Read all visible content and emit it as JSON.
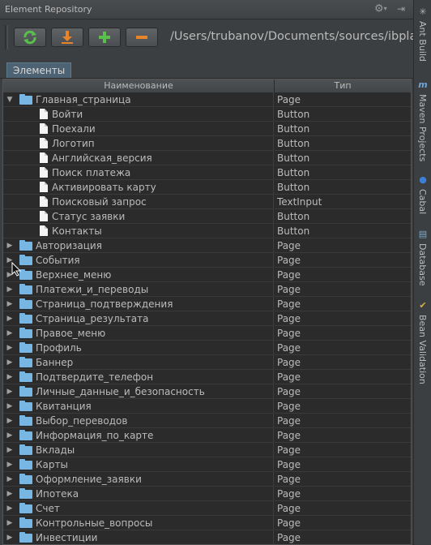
{
  "window": {
    "title": "Element Repository"
  },
  "toolbar": {
    "buttons": [
      {
        "name": "refresh",
        "icon": "refresh-icon"
      },
      {
        "name": "download",
        "icon": "download-icon"
      },
      {
        "name": "add",
        "icon": "plus-icon"
      },
      {
        "name": "remove",
        "icon": "minus-icon"
      }
    ],
    "path": "/Users/trubanov/Documents/sources/ibplatfor"
  },
  "tabs": [
    {
      "label": "Элементы",
      "active": true
    }
  ],
  "table": {
    "columns": [
      "Наименование",
      "Тип"
    ],
    "rows": [
      {
        "name": "Главная_страница",
        "type": "Page",
        "kind": "folder",
        "expanded": true
      },
      {
        "name": "Войти",
        "type": "Button",
        "kind": "leaf"
      },
      {
        "name": "Поехали",
        "type": "Button",
        "kind": "leaf"
      },
      {
        "name": "Логотип",
        "type": "Button",
        "kind": "leaf"
      },
      {
        "name": "Английская_версия",
        "type": "Button",
        "kind": "leaf"
      },
      {
        "name": "Поиск платежа",
        "type": "Button",
        "kind": "leaf"
      },
      {
        "name": "Активировать карту",
        "type": "Button",
        "kind": "leaf"
      },
      {
        "name": "Поисковый запрос",
        "type": "TextInput",
        "kind": "leaf"
      },
      {
        "name": "Статус заявки",
        "type": "Button",
        "kind": "leaf"
      },
      {
        "name": "Контакты",
        "type": "Button",
        "kind": "leaf"
      },
      {
        "name": "Авторизация",
        "type": "Page",
        "kind": "folder",
        "expanded": false
      },
      {
        "name": "События",
        "type": "Page",
        "kind": "folder",
        "expanded": false
      },
      {
        "name": "Верхнее_меню",
        "type": "Page",
        "kind": "folder",
        "expanded": false
      },
      {
        "name": "Платежи_и_переводы",
        "type": "Page",
        "kind": "folder",
        "expanded": false
      },
      {
        "name": "Страница_подтверждения",
        "type": "Page",
        "kind": "folder",
        "expanded": false
      },
      {
        "name": "Страница_результата",
        "type": "Page",
        "kind": "folder",
        "expanded": false
      },
      {
        "name": "Правое_меню",
        "type": "Page",
        "kind": "folder",
        "expanded": false
      },
      {
        "name": "Профиль",
        "type": "Page",
        "kind": "folder",
        "expanded": false
      },
      {
        "name": "Баннер",
        "type": "Page",
        "kind": "folder",
        "expanded": false
      },
      {
        "name": "Подтвердите_телефон",
        "type": "Page",
        "kind": "folder",
        "expanded": false
      },
      {
        "name": "Личные_данные_и_безопасность",
        "type": "Page",
        "kind": "folder",
        "expanded": false
      },
      {
        "name": "Квитанция",
        "type": "Page",
        "kind": "folder",
        "expanded": false
      },
      {
        "name": "Выбор_переводов",
        "type": "Page",
        "kind": "folder",
        "expanded": false
      },
      {
        "name": "Информация_по_карте",
        "type": "Page",
        "kind": "folder",
        "expanded": false
      },
      {
        "name": "Вклады",
        "type": "Page",
        "kind": "folder",
        "expanded": false
      },
      {
        "name": "Карты",
        "type": "Page",
        "kind": "folder",
        "expanded": false
      },
      {
        "name": "Оформление_заявки",
        "type": "Page",
        "kind": "folder",
        "expanded": false
      },
      {
        "name": "Ипотека",
        "type": "Page",
        "kind": "folder",
        "expanded": false
      },
      {
        "name": "Счет",
        "type": "Page",
        "kind": "folder",
        "expanded": false
      },
      {
        "name": "Контрольные_вопросы",
        "type": "Page",
        "kind": "folder",
        "expanded": false
      },
      {
        "name": "Инвестиции",
        "type": "Page",
        "kind": "folder",
        "expanded": false
      }
    ]
  },
  "side_tools": [
    {
      "label": "Ant Build",
      "icon": "ant-icon"
    },
    {
      "label": "Maven Projects",
      "icon": "maven-icon"
    },
    {
      "label": "Cabal",
      "icon": "cabal-icon"
    },
    {
      "label": "Database",
      "icon": "database-icon"
    },
    {
      "label": "Bean Validation",
      "icon": "bean-validation-icon"
    }
  ],
  "colors": {
    "background": "#3c3f41",
    "table_bg": "#2b2b2b",
    "text": "#bbbbbb",
    "folder": "#78b6e4",
    "tab_active": "#4d6273"
  }
}
